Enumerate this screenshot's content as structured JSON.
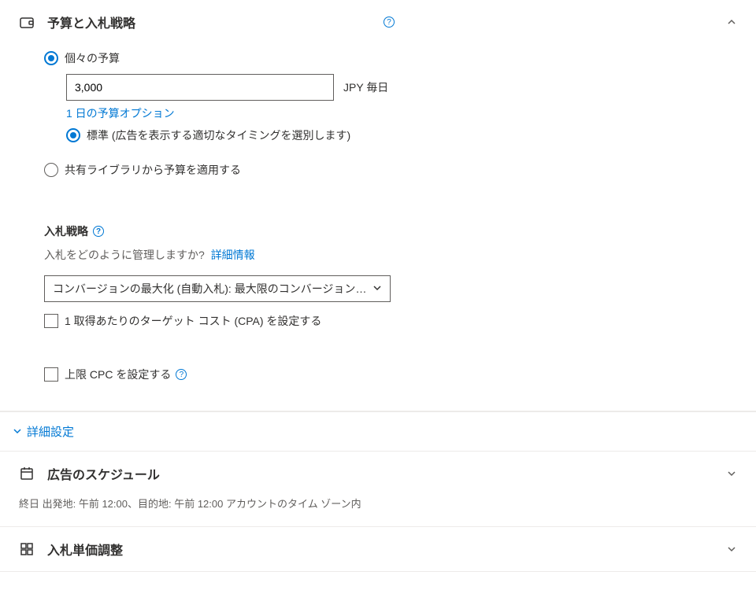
{
  "budget_section": {
    "title": "予算と入札戦略",
    "individual_budget": {
      "label": "個々の予算",
      "value": "3,000",
      "currency_suffix": "JPY 毎日",
      "options_link": "1 日の予算オプション",
      "standard_option": "標準 (広告を表示する適切なタイミングを選別します)"
    },
    "shared_library": {
      "label": "共有ライブラリから予算を適用する"
    },
    "bid_strategy": {
      "title": "入札戦略",
      "question": "入札をどのように管理しますか?",
      "more_info": "詳細情報",
      "select_value": "コンバージョンの最大化 (自動入札): 最大限のコンバージョンを得る",
      "cpa_checkbox": "1 取得あたりのターゲット コスト (CPA) を設定する",
      "cpc_checkbox": "上限 CPC を設定する"
    }
  },
  "advanced_settings": {
    "label": "詳細設定"
  },
  "schedule_section": {
    "title": "広告のスケジュール",
    "summary": "終日 出発地: 午前 12:00、目的地: 午前 12:00 アカウントのタイム ゾーン内"
  },
  "bid_adjustment_section": {
    "title": "入札単価調整"
  }
}
